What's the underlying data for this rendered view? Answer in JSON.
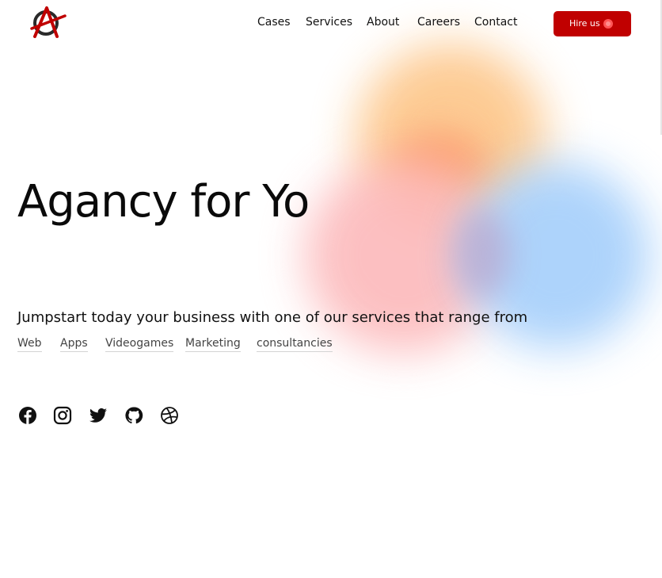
{
  "header": {
    "logo": "anarchy-a-logo",
    "nav": [
      "Cases",
      "Services",
      "About",
      "Careers",
      "Contact"
    ],
    "cta_label": "Hire us",
    "cta_icon": "record-dot-icon"
  },
  "hero": {
    "title": "Agancy for Yo",
    "subtitle": "Jumpstart today your business with one of our services that range from",
    "services": [
      "Web",
      "Apps",
      "Videogames",
      "Marketing",
      "consultancies"
    ]
  },
  "social": [
    "facebook-icon",
    "instagram-icon",
    "twitter-icon",
    "github-icon",
    "dribbble-icon"
  ],
  "colors": {
    "accent": "#c00000",
    "blob_orange": "#fdc98f",
    "blob_pink": "#fcb9bb",
    "blob_blue": "#a9d1fb"
  }
}
